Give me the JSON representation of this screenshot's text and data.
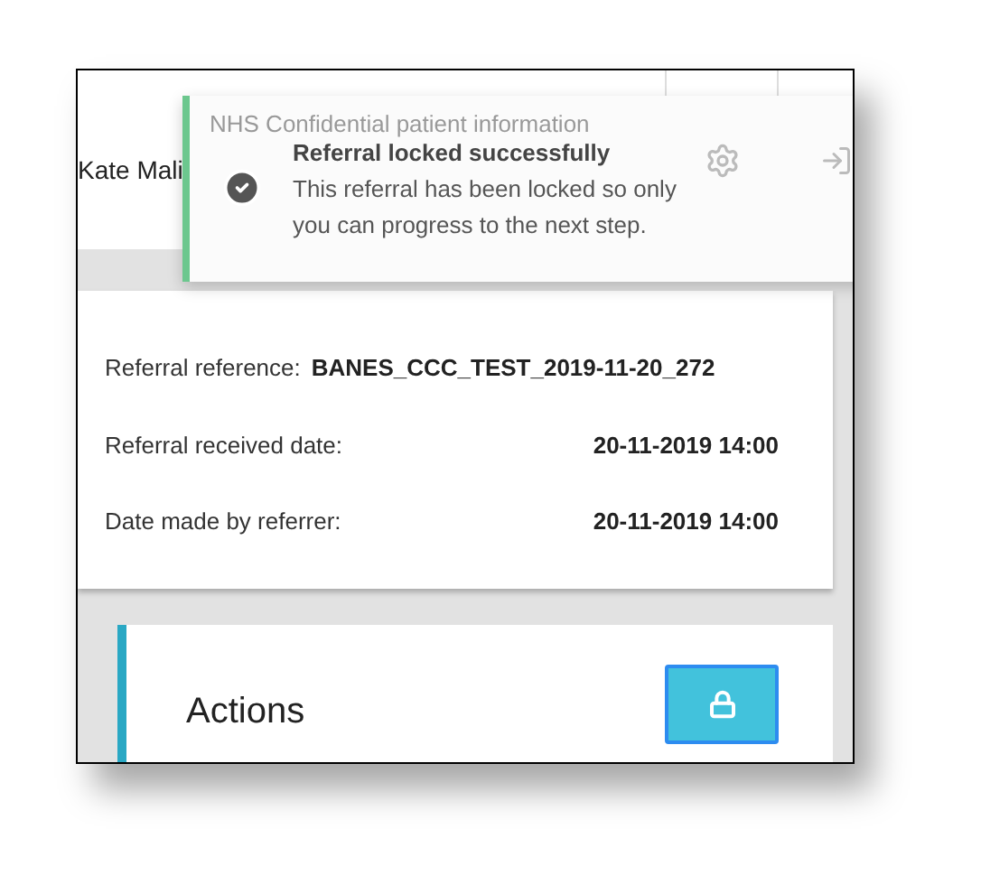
{
  "header": {
    "notice": "NHS Confidential patient information",
    "user": "Kate Mali"
  },
  "toast": {
    "title": "Referral locked successfully",
    "message": "This referral has been locked so only you can progress to the next step."
  },
  "details": [
    {
      "label": "Referral reference:",
      "value": "BANES_CCC_TEST_2019-11-20_272"
    },
    {
      "label": "Referral received date:",
      "value": "20-11-2019 14:00"
    },
    {
      "label": "Date made by referrer:",
      "value": "20-11-2019 14:00"
    }
  ],
  "actions": {
    "title": "Actions"
  }
}
